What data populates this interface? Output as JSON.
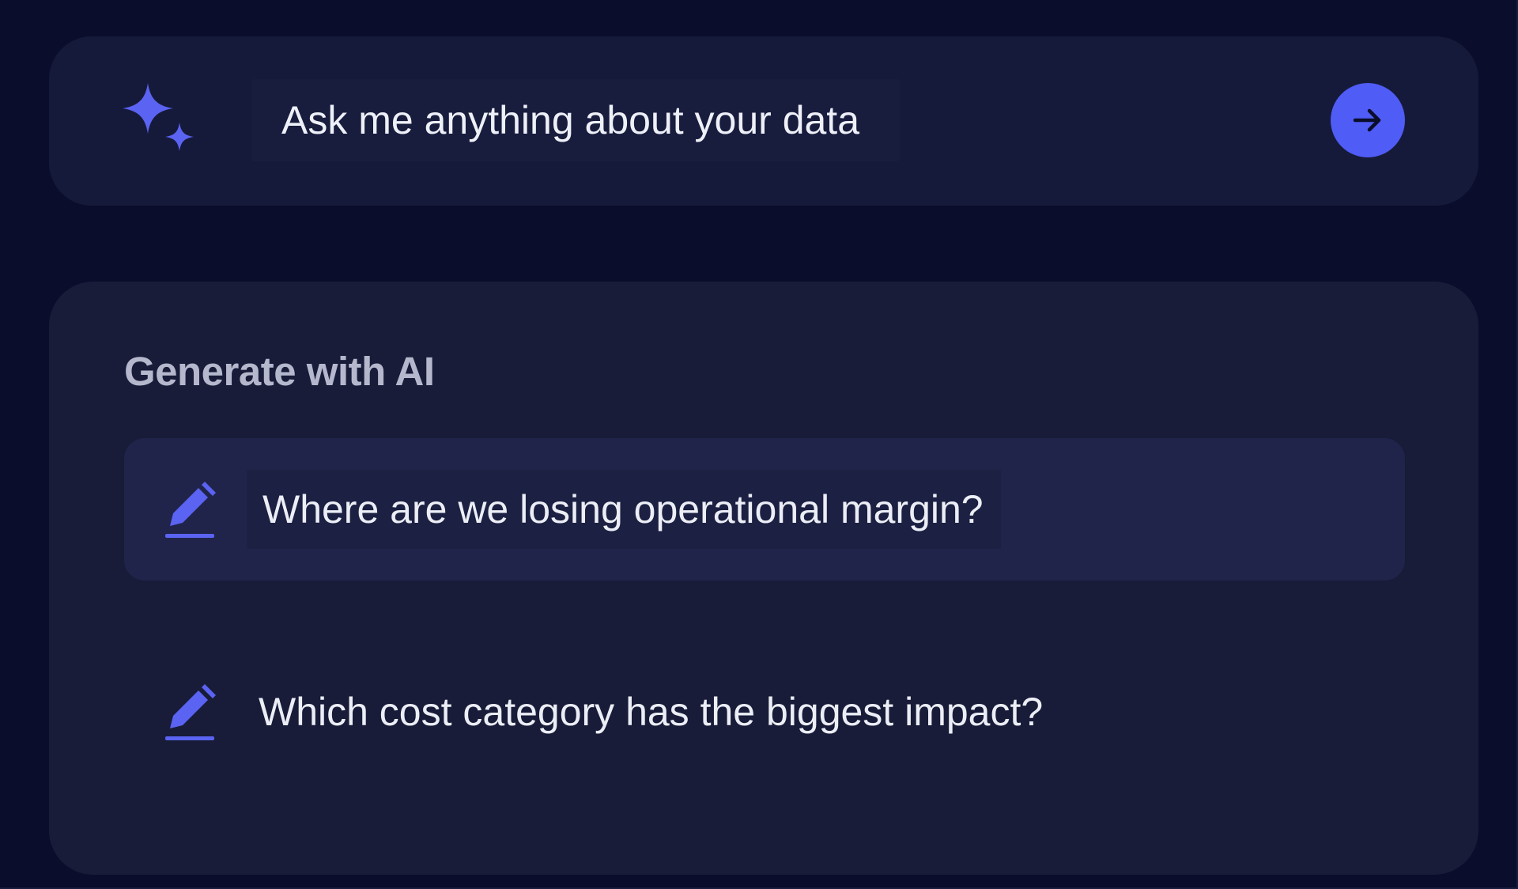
{
  "ask": {
    "placeholder": "Ask me anything about your data",
    "sparkle_icon": "sparkle-icon",
    "send_icon": "arrow-right-icon"
  },
  "generate": {
    "title": "Generate with AI",
    "suggestions": [
      {
        "label": "Where are we losing operational margin?",
        "icon": "pencil-icon",
        "highlighted": true
      },
      {
        "label": "Which cost category has the biggest impact?",
        "icon": "pencil-icon",
        "highlighted": false
      }
    ]
  },
  "colors": {
    "accent": "#4f5cf5",
    "background": "#0a0d2b",
    "card": "#181c39",
    "text": "#eef0f8"
  }
}
